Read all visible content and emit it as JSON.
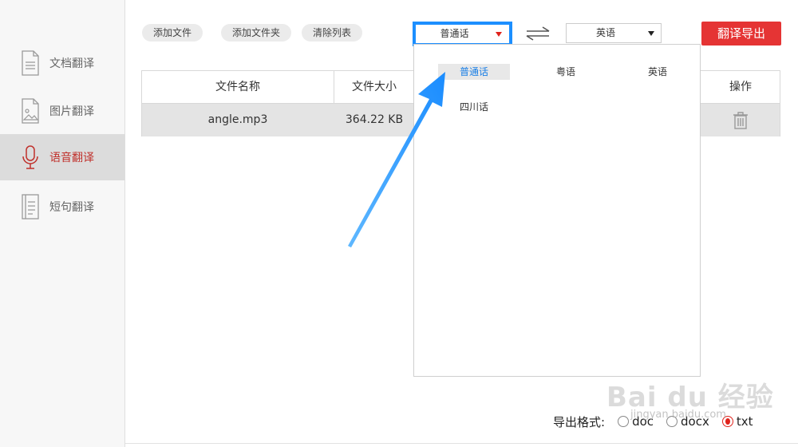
{
  "sidebar": {
    "items": [
      {
        "label": "文档翻译",
        "icon": "document-icon",
        "active": false
      },
      {
        "label": "图片翻译",
        "icon": "image-icon",
        "active": false
      },
      {
        "label": "语音翻译",
        "icon": "microphone-icon",
        "active": true
      },
      {
        "label": "短句翻译",
        "icon": "text-lines-icon",
        "active": false
      }
    ]
  },
  "toolbar": {
    "add_file": "添加文件",
    "add_folder": "添加文件夹",
    "clear_list": "清除列表",
    "source_language": "普通话",
    "target_language": "英语",
    "export_button": "翻译导出"
  },
  "table": {
    "headers": {
      "name": "文件名称",
      "size": "文件大小",
      "action": "操作"
    },
    "rows": [
      {
        "name": "angle.mp3",
        "size": "364.22 KB"
      }
    ]
  },
  "dropdown": {
    "options": [
      "普通话",
      "粤语",
      "英语",
      "四川话"
    ],
    "selected": "普通话"
  },
  "footer": {
    "label": "导出格式:",
    "formats": [
      "doc",
      "docx",
      "txt"
    ],
    "selected": "txt"
  },
  "watermark": {
    "text": "Bai du 经验",
    "sub": "jingyan.baidu.com"
  },
  "colors": {
    "accent_red": "#e53434",
    "highlight_blue": "#1c8fff",
    "active_sidebar_text": "#c0302b"
  }
}
